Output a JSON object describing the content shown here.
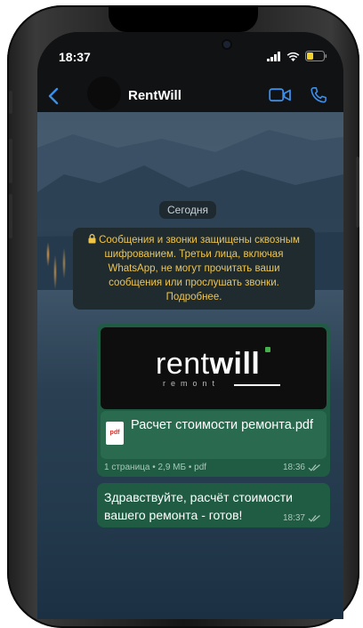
{
  "status_bar": {
    "time": "18:37"
  },
  "header": {
    "contact_name": "RentWill"
  },
  "chat": {
    "date_label": "Сегодня",
    "encryption_notice": "Сообщения и звонки защищены сквозным шифрованием. Третьи лица, включая WhatsApp, не могут прочитать ваши сообщения или прослушать звонки. Подробнее.",
    "document_message": {
      "logo_main": "rent",
      "logo_bold": "will",
      "logo_sub": "remont",
      "file_icon_label": "pdf",
      "file_name": "Расчет стоимости ремонта.pdf",
      "meta": "1 страница • 2,9 МБ • pdf",
      "time": "18:36"
    },
    "text_message": {
      "text": "Здравствуйте, расчёт стоимости вашего ремонта - готов!",
      "time": "18:37"
    }
  },
  "colors": {
    "outgoing_bubble": "#1f5c43",
    "notice_text": "#f1c54a",
    "accent_blue": "#3d8ee9"
  }
}
